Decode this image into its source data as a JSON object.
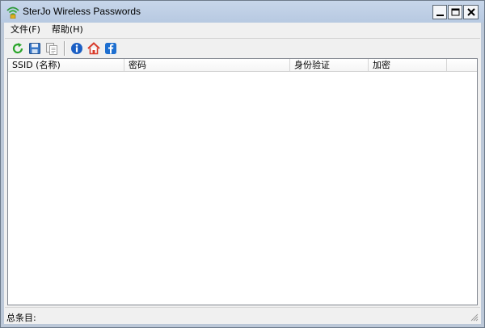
{
  "window": {
    "title": "SterJo Wireless Passwords",
    "controls": {
      "minimize": "minimize",
      "maximize": "maximize",
      "close": "close"
    }
  },
  "menu": {
    "items": [
      {
        "label": "文件(F)"
      },
      {
        "label": "帮助(H)"
      }
    ]
  },
  "toolbar": {
    "buttons": [
      {
        "icon": "refresh-icon",
        "color": "#2aa52a"
      },
      {
        "icon": "save-icon",
        "color": "#3a78c8"
      },
      {
        "icon": "copy-icon",
        "color": "#9a9a9a"
      },
      {
        "icon": "info-icon",
        "color": "#1b5fc4"
      },
      {
        "icon": "home-icon",
        "color": "#d83a2a"
      },
      {
        "icon": "facebook-icon",
        "color": "#1e6fd0"
      }
    ]
  },
  "list": {
    "columns": [
      {
        "label": "SSID (名称)"
      },
      {
        "label": "密码"
      },
      {
        "label": "身份验证"
      },
      {
        "label": "加密"
      }
    ],
    "rows": []
  },
  "status": {
    "total_label": "总条目:"
  }
}
